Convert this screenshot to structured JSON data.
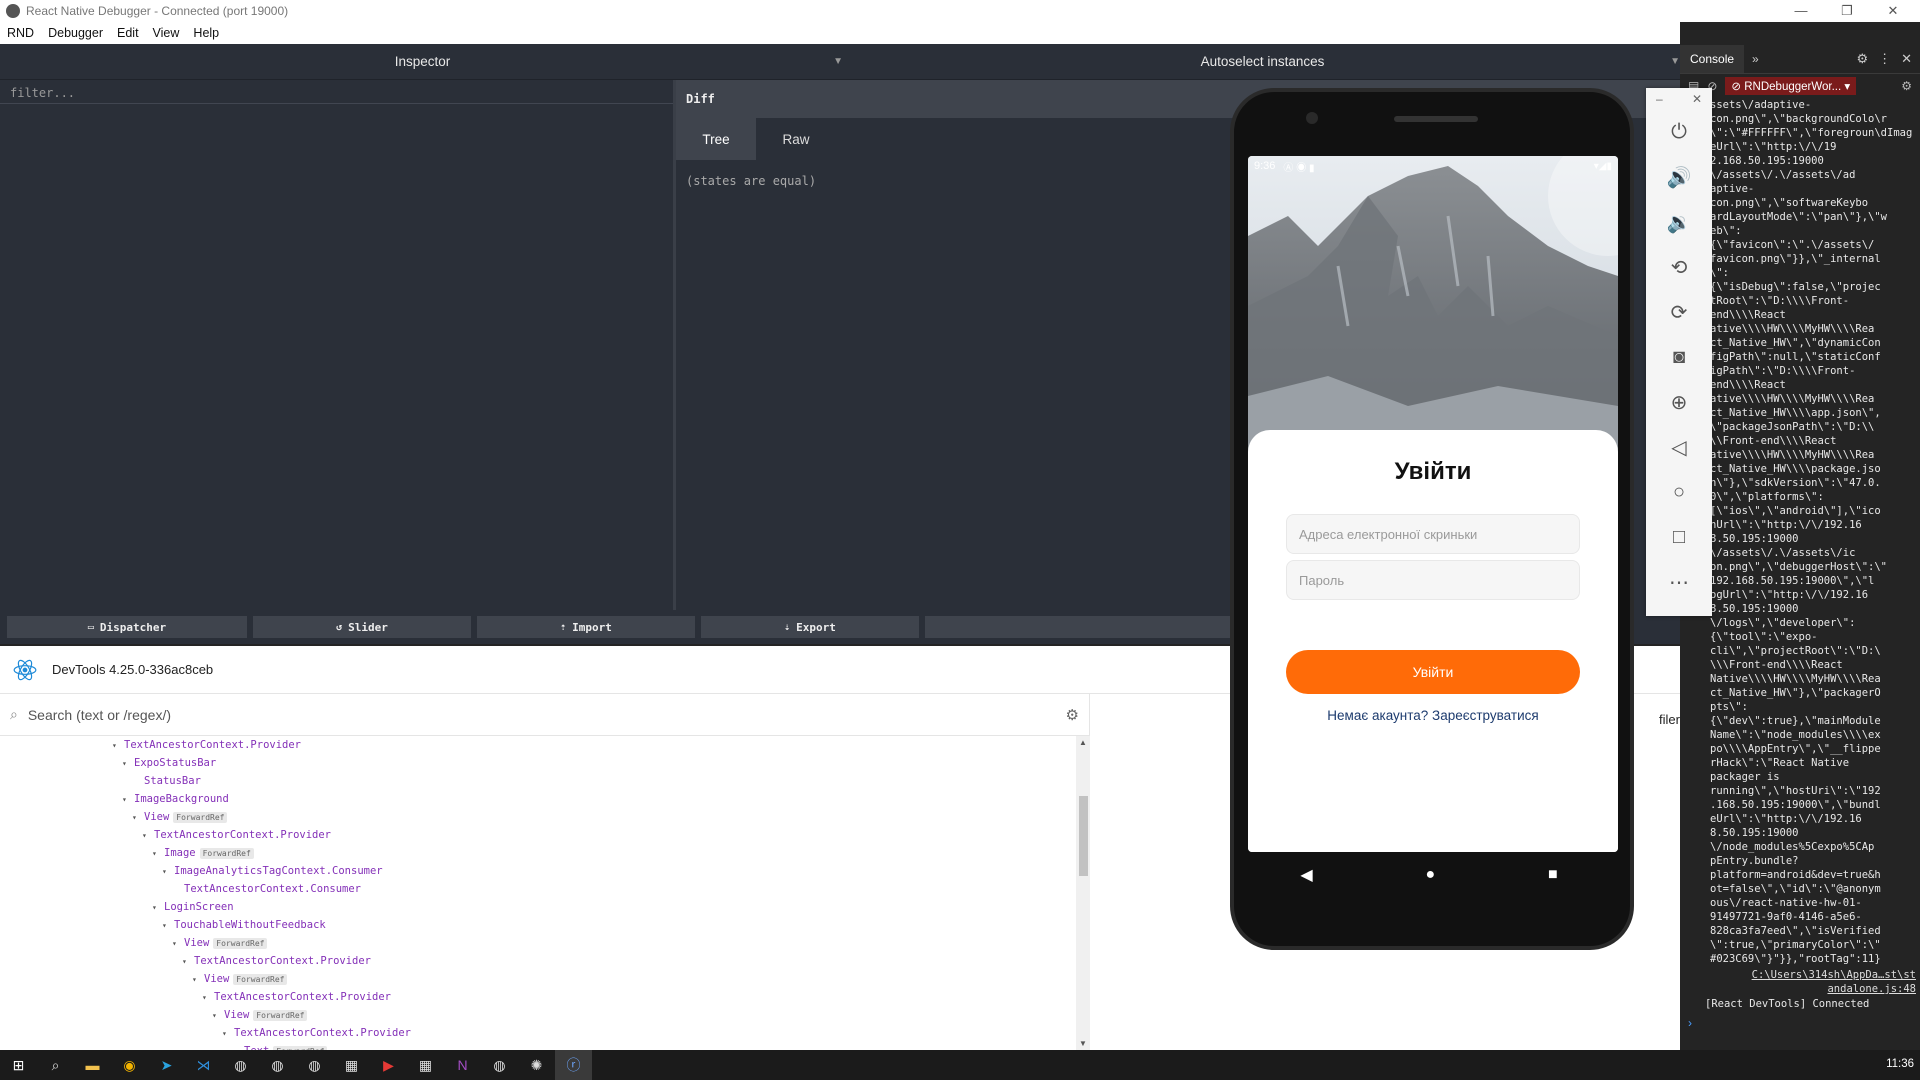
{
  "window": {
    "title": "React Native Debugger - Connected (port 19000)",
    "controls": [
      "—",
      "❐",
      "✕"
    ]
  },
  "menu": [
    "RND",
    "Debugger",
    "Edit",
    "View",
    "Help"
  ],
  "inspector": {
    "left_title": "Inspector",
    "right_title": "Autoselect instances",
    "filter_placeholder": "filter..."
  },
  "diff": {
    "header": "Diff",
    "tabs": [
      "Tree",
      "Raw"
    ],
    "active_tab": "Tree",
    "body": "(states are equal)"
  },
  "actions": [
    "Dispatcher",
    "Slider",
    "Import",
    "Export"
  ],
  "devtools": {
    "title": "DevTools 4.25.0-336ac8ceb",
    "search_placeholder": "Search (text or /regex/)",
    "profiler_label": "filer",
    "tree": [
      {
        "indent": 0,
        "arrow": "▾",
        "name": "TextAncestorContext.Provider",
        "badge": ""
      },
      {
        "indent": 1,
        "arrow": "▾",
        "name": "ExpoStatusBar",
        "badge": ""
      },
      {
        "indent": 2,
        "arrow": "",
        "name": "StatusBar",
        "badge": ""
      },
      {
        "indent": 1,
        "arrow": "▾",
        "name": "ImageBackground",
        "badge": ""
      },
      {
        "indent": 2,
        "arrow": "▾",
        "name": "View",
        "badge": "ForwardRef"
      },
      {
        "indent": 3,
        "arrow": "▾",
        "name": "TextAncestorContext.Provider",
        "badge": ""
      },
      {
        "indent": 4,
        "arrow": "▾",
        "name": "Image",
        "badge": "ForwardRef"
      },
      {
        "indent": 5,
        "arrow": "▾",
        "name": "ImageAnalyticsTagContext.Consumer",
        "badge": ""
      },
      {
        "indent": 6,
        "arrow": "",
        "name": "TextAncestorContext.Consumer",
        "badge": ""
      },
      {
        "indent": 4,
        "arrow": "▾",
        "name": "LoginScreen",
        "badge": ""
      },
      {
        "indent": 5,
        "arrow": "▾",
        "name": "TouchableWithoutFeedback",
        "badge": ""
      },
      {
        "indent": 6,
        "arrow": "▾",
        "name": "View",
        "badge": "ForwardRef"
      },
      {
        "indent": 7,
        "arrow": "▾",
        "name": "TextAncestorContext.Provider",
        "badge": ""
      },
      {
        "indent": 8,
        "arrow": "▾",
        "name": "View",
        "badge": "ForwardRef"
      },
      {
        "indent": 9,
        "arrow": "▾",
        "name": "TextAncestorContext.Provider",
        "badge": ""
      },
      {
        "indent": 10,
        "arrow": "▾",
        "name": "View",
        "badge": "ForwardRef"
      },
      {
        "indent": 11,
        "arrow": "▾",
        "name": "TextAncestorContext.Provider",
        "badge": ""
      },
      {
        "indent": 12,
        "arrow": "▾",
        "name": "Text",
        "badge": "ForwardRef"
      }
    ]
  },
  "console": {
    "tab": "Console",
    "context": "RNDebuggerWor...",
    "log": "ssets\\/adaptive-\ncon.png\\\",\\\"backgroundColo\\r\\\":\\\"#FFFFFF\\\",\\\"foregroun\\dImageUrl\\\":\\\"http:\\/\\/19\n2.168.50.195:19000\n\\/assets\\/.\\/assets\\/ad\naptive-\ncon.png\\\",\\\"softwareKeybo\nardLayoutMode\\\":\\\"pan\\\"},\\\"w\neb\\\":\n{\\\"favicon\\\":\\\".\\/assets\\/\nfavicon.png\\\"}},\\\"_internal\n\\\":\n{\\\"isDebug\\\":false,\\\"projec\ntRoot\\\":\\\"D:\\\\\\\\Front-\nend\\\\\\\\React\native\\\\\\\\HW\\\\\\\\MyHW\\\\\\\\Rea\nct_Native_HW\\\",\\\"dynamicCon\nfigPath\\\":null,\\\"staticConf\nigPath\\\":\\\"D:\\\\\\\\Front-\nend\\\\\\\\React\native\\\\\\\\HW\\\\\\\\MyHW\\\\\\\\Rea\nct_Native_HW\\\\\\\\app.json\\\",\n\\\"packageJsonPath\\\":\\\"D:\\\\\n\\\\Front-end\\\\\\\\React\native\\\\\\\\HW\\\\\\\\MyHW\\\\\\\\Rea\nct_Native_HW\\\\\\\\package.jso\nn\\\"},\\\"sdkVersion\\\":\\\"47.0.\n0\\\",\\\"platforms\\\":\n[\\\"ios\\\",\\\"android\\\"],\\\"ico\nnUrl\\\":\\\"http:\\/\\/192.16\n8.50.195:19000\n\\/assets\\/.\\/assets\\/ic\non.png\\\",\\\"debuggerHost\\\":\\\"\n192.168.50.195:19000\\\",\\\"l\nogUrl\\\":\\\"http:\\/\\/192.16\n8.50.195:19000\n\\/logs\\\",\\\"developer\\\":\n{\\\"tool\\\":\\\"expo-\ncli\\\",\\\"projectRoot\\\":\\\"D:\\\n\\\\\\Front-end\\\\\\\\React\nNative\\\\\\\\HW\\\\\\\\MyHW\\\\\\\\Rea\nct_Native_HW\\\"},\\\"packagerO\npts\\\":\n{\\\"dev\\\":true},\\\"mainModule\nName\\\":\\\"node_modules\\\\\\\\ex\npo\\\\\\\\AppEntry\\\",\\\"__flippe\nrHack\\\":\\\"React Native\npackager is\nrunning\\\",\\\"hostUri\\\":\\\"192\n.168.50.195:19000\\\",\\\"bundl\neUrl\\\":\\\"http:\\/\\/192.16\n8.50.195:19000\n\\/node_modules%5Cexpo%5CAp\npEntry.bundle?\nplatform=android&dev=true&h\not=false\\\",\\\"id\\\":\\\"@anonym\nous\\/react-native-hw-01-\n91497721-9af0-4146-a5e6-\n828ca3fa7eed\\\",\\\"isVerified\n\\\":true,\\\"primaryColor\\\":\\\"\n#023C69\\\"}\"}},\"rootTag\":11}",
    "source": "C:\\Users\\314sh\\AppDa…st\\st\nandalone.js:48",
    "last_line": "[React DevTools] Connected",
    "prompt": "›"
  },
  "phone": {
    "time": "9:36",
    "title": "Увійти",
    "email_placeholder": "Адреса електронної скриньки",
    "password_placeholder": "Пароль",
    "login_button": "Увійти",
    "register_link": "Немає акаунта? Зареєструватися",
    "nav": [
      "◀",
      "●",
      "■"
    ],
    "accent": "#ff6b08"
  },
  "taskbar": {
    "icons": [
      "windows-start-icon",
      "search-icon",
      "file-explorer-icon",
      "chrome-icon",
      "telegram-icon",
      "vscode-icon",
      "app-icon",
      "app-icon",
      "app-icon",
      "calculator-icon",
      "youtube-icon",
      "calculator-icon",
      "onenote-icon",
      "app-icon",
      "chatgpt-icon",
      "react-native-debugger-icon"
    ],
    "time": "11:36"
  }
}
